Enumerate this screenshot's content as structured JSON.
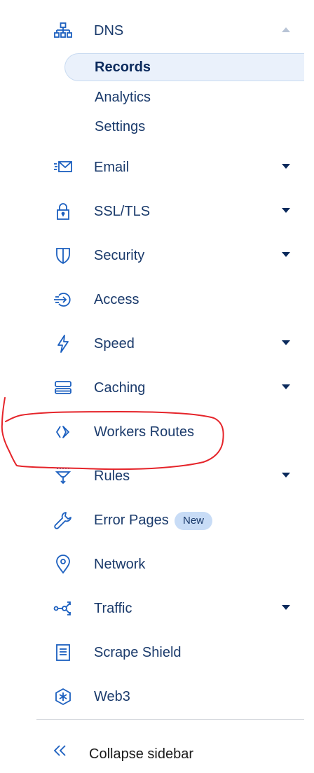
{
  "sidebar": {
    "dns": {
      "label": "DNS",
      "icon": "network-tree-icon",
      "expanded": true,
      "subitems": [
        {
          "label": "Records",
          "active": true
        },
        {
          "label": "Analytics",
          "active": false
        },
        {
          "label": "Settings",
          "active": false
        }
      ]
    },
    "items": [
      {
        "label": "Email",
        "icon": "envelope-icon",
        "has_dropdown": true
      },
      {
        "label": "SSL/TLS",
        "icon": "lock-icon",
        "has_dropdown": true
      },
      {
        "label": "Security",
        "icon": "shield-icon",
        "has_dropdown": true
      },
      {
        "label": "Access",
        "icon": "access-login-icon",
        "has_dropdown": false
      },
      {
        "label": "Speed",
        "icon": "lightning-icon",
        "has_dropdown": true
      },
      {
        "label": "Caching",
        "icon": "server-stack-icon",
        "has_dropdown": true
      },
      {
        "label": "Workers Routes",
        "icon": "workers-chevron-icon",
        "has_dropdown": false
      },
      {
        "label": "Rules",
        "icon": "filter-funnel-icon",
        "has_dropdown": true
      },
      {
        "label": "Error Pages",
        "icon": "wrench-icon",
        "has_dropdown": false,
        "badge": "New"
      },
      {
        "label": "Network",
        "icon": "location-pin-icon",
        "has_dropdown": false
      },
      {
        "label": "Traffic",
        "icon": "traffic-share-icon",
        "has_dropdown": true
      },
      {
        "label": "Scrape Shield",
        "icon": "document-icon",
        "has_dropdown": false
      },
      {
        "label": "Web3",
        "icon": "web3-hexagon-icon",
        "has_dropdown": false
      }
    ],
    "collapse_label": "Collapse sidebar",
    "collapse_icon": "double-chevron-left-icon"
  },
  "colors": {
    "icon_blue": "#1b5fbf",
    "text_navy": "#1a3a6b",
    "active_bg": "#eaf1fb",
    "badge_bg": "#c8dcf6",
    "annotation_red": "#e5242a"
  }
}
